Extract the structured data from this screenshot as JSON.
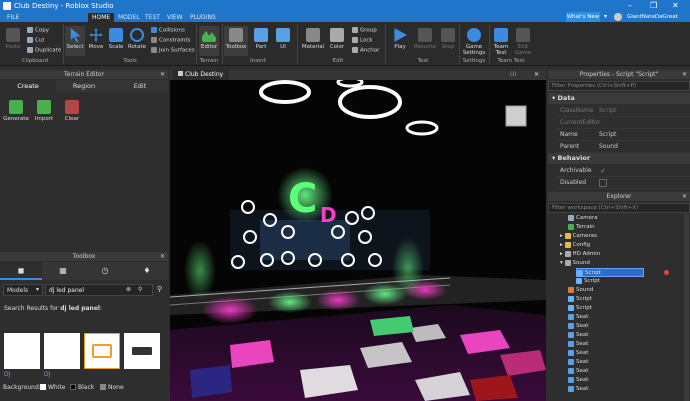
{
  "window": {
    "title": "Club Destiny - Roblox Studio",
    "minimize": "–",
    "maximize": "❐",
    "close": "✕"
  },
  "menu": {
    "file": "FILE",
    "tabs": [
      "HOME",
      "MODEL",
      "TEST",
      "VIEW",
      "PLUGINS"
    ],
    "whats_new": "What's New",
    "user": "GiantNateDaGreat"
  },
  "ribbon": {
    "clipboard": {
      "paste": "Paste",
      "copy": "Copy",
      "cut": "Cut",
      "duplicate": "Duplicate",
      "group": "Clipboard"
    },
    "tools": {
      "select": "Select",
      "move": "Move",
      "scale": "Scale",
      "rotate": "Rotate",
      "collisions": "Collisions",
      "constraints": "Constraints",
      "join_surfaces": "Join Surfaces",
      "group": "Tools"
    },
    "terrain": {
      "editor": "Editor",
      "group": "Terrain"
    },
    "insert": {
      "toolbox": "Toolbox",
      "part": "Part",
      "ui": "UI",
      "group": "Insert"
    },
    "edit": {
      "material": "Material",
      "color": "Color",
      "group_btn": "Group",
      "lock": "Lock",
      "anchor": "Anchor",
      "group": "Edit"
    },
    "test": {
      "play": "Play",
      "resume": "Resume",
      "stop": "Stop",
      "group": "Test"
    },
    "settings": {
      "game_settings": "Game Settings",
      "group": "Settings"
    },
    "team_test": {
      "team_test": "Team Test",
      "exit_game": "Exit Game",
      "group": "Team Test"
    }
  },
  "terrain_editor": {
    "title": "Terrain Editor",
    "tabs": [
      "Create",
      "Region",
      "Edit"
    ],
    "tools": [
      "Generate",
      "Import",
      "Clear"
    ]
  },
  "toolbox": {
    "title": "Toolbox",
    "category": "Models",
    "search_value": "dj led panel",
    "results_prefix": "Search Results for ",
    "results_query": "dj led panel",
    "results_suffix": ":",
    "items": [
      "DJ",
      "DJ",
      "",
      ""
    ],
    "background_label": "Background:",
    "bg_options": [
      "White",
      "Black",
      "None"
    ]
  },
  "viewport": {
    "tab": "Club Destiny",
    "ui_label": "UI",
    "close": "✕",
    "sign_text": "CD"
  },
  "properties": {
    "title": "Properties - Script \"Script\"",
    "filter_placeholder": "Filter Properties (Ctrl+Shift+P)",
    "sections": {
      "data": "Data",
      "behavior": "Behavior"
    },
    "rows": [
      {
        "name": "ClassName",
        "value": "Script"
      },
      {
        "name": "CurrentEditor",
        "value": ""
      },
      {
        "name": "Name",
        "value": "Script"
      },
      {
        "name": "Parent",
        "value": "Sound"
      }
    ],
    "behavior_rows": [
      {
        "name": "Archivable",
        "value": "✓"
      },
      {
        "name": "Disabled",
        "value": ""
      }
    ]
  },
  "explorer": {
    "title": "Explorer",
    "filter_placeholder": "Filter workspace (Ctrl+Shift+X)",
    "items": [
      "Camera",
      "Terrain",
      "Cameras",
      "Config",
      "HD Admin",
      "Sound",
      "Script",
      "Script",
      "Sound",
      "Script",
      "Script",
      "Seat",
      "Seat",
      "Seat",
      "Seat",
      "Seat",
      "Seat",
      "Seat",
      "Seat",
      "Seat"
    ]
  },
  "colors": {
    "accent": "#1f75c9",
    "panel": "#2e2e2e",
    "selection": "#2f6bc7",
    "neon_green": "#5cff7a",
    "neon_pink": "#ff3cc8"
  }
}
